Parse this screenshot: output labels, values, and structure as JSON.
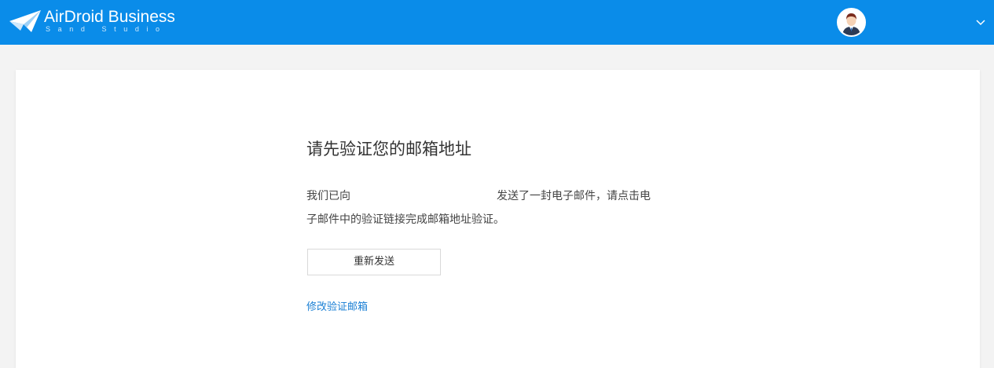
{
  "header": {
    "brand": "AirDroid Business",
    "brand_sub": "Sand Studio",
    "avatar_icon": "user-avatar-icon",
    "menu_icon": "chevron-down-icon",
    "bar_color": "#0a8ce9"
  },
  "verify": {
    "title": "请先验证您的邮箱地址",
    "desc_line1_prefix": "我们已向",
    "desc_line1_suffix": "发送了一封电子邮件，请点击电",
    "desc_line2": "子邮件中的验证链接完成邮箱地址验证。",
    "resend_label": "重新发送",
    "change_email_link": "修改验证邮箱",
    "link_color": "#1a7fd4"
  }
}
